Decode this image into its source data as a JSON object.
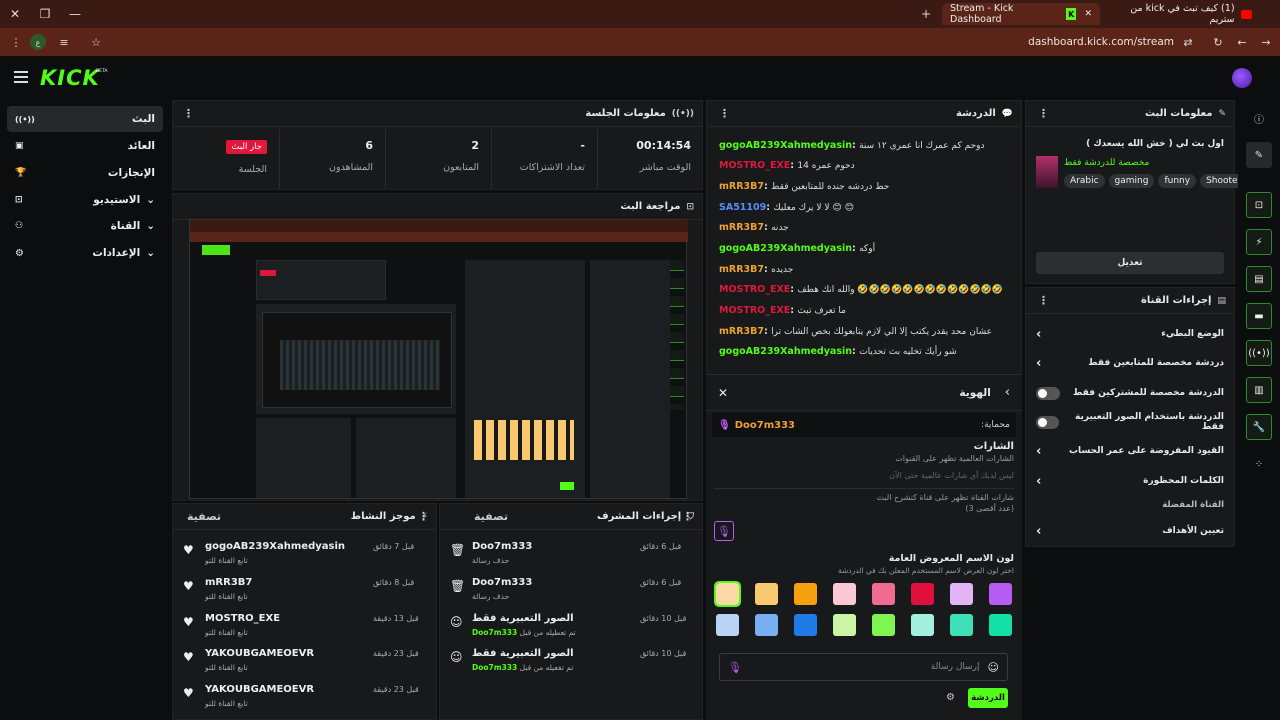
{
  "browser": {
    "tabs": [
      {
        "title": "Stream - Kick Dashboard",
        "active": true
      },
      {
        "title": "(1) كيف تبث في kick من ستريم",
        "active": false
      }
    ],
    "url": "dashboard.kick.com/stream"
  },
  "brand": {
    "logo": "KICK",
    "beta": "BETA",
    "accent": "#53fc18"
  },
  "left_nav": [
    {
      "label": "البث",
      "icon": "broadcast-icon",
      "selected": true
    },
    {
      "label": "العائد",
      "icon": "revenue-icon"
    },
    {
      "label": "الإنجازات",
      "icon": "trophy-icon"
    },
    {
      "label": "الاستيديو",
      "icon": "studio-icon",
      "expandable": true
    },
    {
      "label": "القناة",
      "icon": "channel-icon",
      "expandable": true
    },
    {
      "label": "الإعدادات",
      "icon": "gear-icon",
      "expandable": true
    }
  ],
  "session": {
    "title": "معلومات الجلسة",
    "live_badge": "جار البث",
    "stats": [
      {
        "label": "الجلسة",
        "value": ""
      },
      {
        "label": "المشاهدون",
        "value": "6"
      },
      {
        "label": "المتابعون",
        "value": "2"
      },
      {
        "label": "تعداد الاشتراكات",
        "value": "-"
      },
      {
        "label": "الوقت مباشر",
        "value": "00:14:54"
      }
    ]
  },
  "preview": {
    "title": "مراجعة البث"
  },
  "activity": {
    "title": "موجز النشاط",
    "filter": "تصفية",
    "items": [
      {
        "name": "gogoAB239Xahmedyasin",
        "sub": "تابع القناة للتو",
        "time": "قبل 7 دقائق"
      },
      {
        "name": "mRR3B7",
        "sub": "تابع القناة للتو",
        "time": "قبل 8 دقائق"
      },
      {
        "name": "MOSTRO_EXE",
        "sub": "تابع القناة للتو",
        "time": "قبل 13 دقيقة"
      },
      {
        "name": "YAKOUBGAMEOEVR",
        "sub": "تابع القناة للتو",
        "time": "قبل 23 دقيقة"
      },
      {
        "name": "YAKOUBGAMEOEVR",
        "sub": "تابع القناة للتو",
        "time": "قبل 23 دقيقة"
      }
    ]
  },
  "modactions": {
    "title": "إجراءات المشرف",
    "filter": "تصفية",
    "items": [
      {
        "name": "Doo7m333",
        "sub": "حذف رسالة",
        "time": "قبل 6 دقائق",
        "icon": "trash-icon"
      },
      {
        "name": "Doo7m333",
        "sub": "حذف رسالة",
        "time": "قبل 6 دقائق",
        "icon": "trash-icon"
      },
      {
        "name": "الصور التعبيرية فقط",
        "sub": "تم تعطيله من قبل",
        "user": "Doo7m333",
        "time": "قبل 10 دقائق",
        "icon": "emoji-icon"
      },
      {
        "name": "الصور التعبيرية فقط",
        "sub": "تم تفعيله من قبل",
        "user": "Doo7m333",
        "time": "قبل 10 دقائق",
        "icon": "emoji-icon"
      }
    ]
  },
  "chat": {
    "title": "الدردشة",
    "messages": [
      {
        "user": "gogoAB239Xahmedyasin",
        "color": "#53fc18",
        "text": "دوحم كم عمرك انا عمري ١٢ سنة"
      },
      {
        "user": "MOSTRO_EXE",
        "color": "#e0183c",
        "text": "دحوم عمره 14"
      },
      {
        "user": "mRR3B7",
        "color": "#f0a030",
        "text": "حط دردشه جنده للمتابعين فقط"
      },
      {
        "user": "SA51109",
        "color": "#5a8cff",
        "text": "لا لا يرك معليك 😊 😊"
      },
      {
        "user": "mRR3B7",
        "color": "#f0a030",
        "text": "جدنه"
      },
      {
        "user": "gogoAB239Xahmedyasin",
        "color": "#53fc18",
        "text": "أوكه"
      },
      {
        "user": "mRR3B7",
        "color": "#f0a030",
        "text": "جديده"
      },
      {
        "user": "MOSTRO_EXE",
        "color": "#e0183c",
        "text": "والله انك هطف 🤣🤣🤣🤣🤣🤣🤣🤣🤣🤣🤣🤣🤣"
      },
      {
        "user": "MOSTRO_EXE",
        "color": "#e0183c",
        "text": "ما تعرف تبث"
      },
      {
        "user": "mRR3B7",
        "color": "#f0a030",
        "text": "عشان محد يقدر يكتب إلا الي لازم يتابعولك بخص الشات ترا"
      },
      {
        "user": "gogoAB239Xahmedyasin",
        "color": "#53fc18",
        "text": "شو رأيك تخليه بث تحديات"
      }
    ],
    "input_placeholder": "إرسال رسالة",
    "send_label": "الدردشة"
  },
  "identity": {
    "title": "الهوية",
    "user": "Doo7m333",
    "protected_label": "محماية:",
    "badges_title": "الشارات",
    "badges_desc": "الشارات العالمية تظهر على القنوات",
    "badges_empty": "ليس لديك أي شارات عالمية حتى الآن",
    "channel_badges_desc": "شارات القناة تظهر على قناة كنشرح البث",
    "channel_badges_count": "(عدد أقصى 3)",
    "color_title": "لون الاسم المعروض العامة",
    "color_desc": "اختر لون العرض لاسم المستخدم المعلن بك في الدردشة",
    "colors": [
      "#fbd9a4",
      "#f9c86f",
      "#f5a10e",
      "#fbc8d6",
      "#ef6b8f",
      "#e0103c",
      "#e4b3f5",
      "#b55cf5",
      "#b7d4f5",
      "#79aef0",
      "#1e7be8",
      "#c9f5a4",
      "#7ef551",
      "#a4f0de",
      "#3ee0b8",
      "#12e0a6"
    ]
  },
  "streaminfo": {
    "title": "معلومات البث",
    "stream_title": "اول بث لي ( خش الله يسعدك )",
    "category": "مخصصة للدردشة فقط",
    "tags": [
      "Arabic",
      "gaming",
      "funny",
      "Shooter"
    ],
    "edit_label": "تعديل"
  },
  "channel_actions": {
    "title": "إجراءات القناة",
    "items": [
      {
        "label": "الوضع البطيء",
        "type": "chevron"
      },
      {
        "label": "دردشة مخصصة للمتابعين فقط",
        "type": "chevron"
      },
      {
        "label": "الدردشة مخصصة للمشتركين فقط",
        "type": "toggle"
      },
      {
        "label": "الدردشة باستخدام الصور التعبيرية فقط",
        "type": "toggle"
      },
      {
        "label": "القيود المفروضة على عمر الحساب",
        "type": "chevron"
      },
      {
        "label": "الكلمات المحظورة",
        "type": "chevron"
      }
    ],
    "fav_label": "القناة المفضلة",
    "goals_label": "تعيين الأهداف"
  }
}
